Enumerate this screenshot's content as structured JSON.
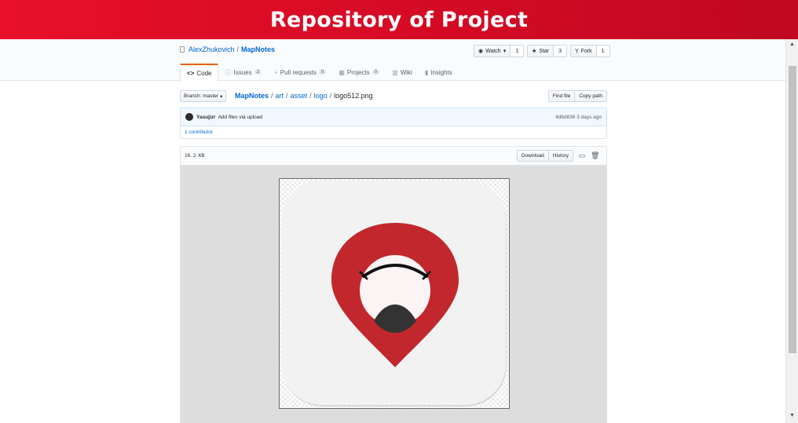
{
  "banner": {
    "title": "Repository of Project"
  },
  "repo": {
    "owner": "AlexZhukovich",
    "separator": "/",
    "name": "MapNotes"
  },
  "actions": {
    "watch": {
      "label": "Watch",
      "count": "1"
    },
    "star": {
      "label": "Star",
      "count": "3"
    },
    "fork": {
      "label": "Fork",
      "count": "1"
    }
  },
  "tabs": [
    {
      "label": "Code"
    },
    {
      "label": "Issues",
      "count": "2"
    },
    {
      "label": "Pull requests",
      "count": "0"
    },
    {
      "label": "Projects",
      "count": "0"
    },
    {
      "label": "Wiki"
    },
    {
      "label": "Insights"
    }
  ],
  "file_nav": {
    "branch_label": "Branch: master",
    "breadcrumb": [
      "MapNotes",
      "art",
      "asset",
      "logo",
      "logo512.png"
    ],
    "find_file": "Find file",
    "copy_path": "Copy path"
  },
  "commit": {
    "author": "Yasujizr",
    "message": "Add files via upload",
    "meta": "4d6d836 3 days ago"
  },
  "contributors": {
    "text": "1 contributor"
  },
  "file": {
    "size": "16.2 KB",
    "download": "Download",
    "history": "History"
  },
  "colors": {
    "banner": "#e8102a",
    "pin_red": "#c1272d",
    "icon_bg": "#f2f2f2",
    "link": "#0366d6",
    "tab_accent": "#e36209"
  }
}
